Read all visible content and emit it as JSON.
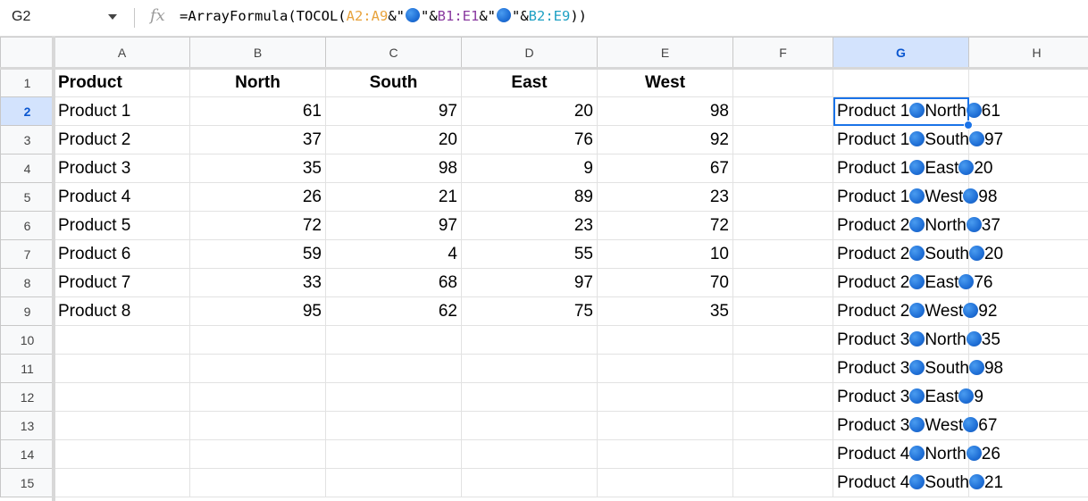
{
  "formula_bar": {
    "name_box": "G2",
    "fx_label": "fx",
    "formula_parts": [
      {
        "text": "=ArrayFormula(TOCOL(",
        "cls": ""
      },
      {
        "text": "A2:A9",
        "cls": "c-a"
      },
      {
        "text": "&\"",
        "cls": ""
      },
      {
        "text": "●",
        "cls": "dot"
      },
      {
        "text": "\"&",
        "cls": ""
      },
      {
        "text": "B1:E1",
        "cls": "c-b"
      },
      {
        "text": "&\"",
        "cls": ""
      },
      {
        "text": "●",
        "cls": "dot"
      },
      {
        "text": "\"&",
        "cls": ""
      },
      {
        "text": "B2:E9",
        "cls": "c-c"
      },
      {
        "text": "))",
        "cls": ""
      }
    ]
  },
  "columns": [
    "A",
    "B",
    "C",
    "D",
    "E",
    "F",
    "G",
    "H"
  ],
  "selected_column": "G",
  "selected_row": 2,
  "row_numbers": [
    "1",
    "2",
    "3",
    "4",
    "5",
    "6",
    "7",
    "8",
    "9",
    "10",
    "11",
    "12",
    "13",
    "14",
    "15"
  ],
  "header_row": {
    "a": "Product",
    "b": "North",
    "c": "South",
    "d": "East",
    "e": "West"
  },
  "data_rows": [
    {
      "a": "Product 1",
      "b": "61",
      "c": "97",
      "d": "20",
      "e": "98"
    },
    {
      "a": "Product 2",
      "b": "37",
      "c": "20",
      "d": "76",
      "e": "92"
    },
    {
      "a": "Product 3",
      "b": "35",
      "c": "98",
      "d": "9",
      "e": "67"
    },
    {
      "a": "Product 4",
      "b": "26",
      "c": "21",
      "d": "89",
      "e": "23"
    },
    {
      "a": "Product 5",
      "b": "72",
      "c": "97",
      "d": "23",
      "e": "72"
    },
    {
      "a": "Product 6",
      "b": "59",
      "c": "4",
      "d": "55",
      "e": "10"
    },
    {
      "a": "Product 7",
      "b": "33",
      "c": "68",
      "d": "97",
      "e": "70"
    },
    {
      "a": "Product 8",
      "b": "95",
      "c": "62",
      "d": "75",
      "e": "35"
    }
  ],
  "col_g_results": [
    {
      "p": "Product 1",
      "r": "North",
      "v": "61"
    },
    {
      "p": "Product 1",
      "r": "South",
      "v": "97"
    },
    {
      "p": "Product 1",
      "r": "East",
      "v": "20"
    },
    {
      "p": "Product 1",
      "r": "West",
      "v": "98"
    },
    {
      "p": "Product 2",
      "r": "North",
      "v": "37"
    },
    {
      "p": "Product 2",
      "r": "South",
      "v": "20"
    },
    {
      "p": "Product 2",
      "r": "East",
      "v": "76"
    },
    {
      "p": "Product 2",
      "r": "West",
      "v": "92"
    },
    {
      "p": "Product 3",
      "r": "North",
      "v": "35"
    },
    {
      "p": "Product 3",
      "r": "South",
      "v": "98"
    },
    {
      "p": "Product 3",
      "r": "East",
      "v": "9"
    },
    {
      "p": "Product 3",
      "r": "West",
      "v": "67"
    },
    {
      "p": "Product 4",
      "r": "North",
      "v": "26"
    },
    {
      "p": "Product 4",
      "r": "South",
      "v": "21"
    }
  ],
  "colors": {
    "selection": "#1a73e8",
    "header_selected_bg": "#d3e3fd",
    "range_a": "#e8a33d",
    "range_b": "#8a3ba0",
    "range_c": "#1fa1c4",
    "dot": "#1f6fd6"
  }
}
